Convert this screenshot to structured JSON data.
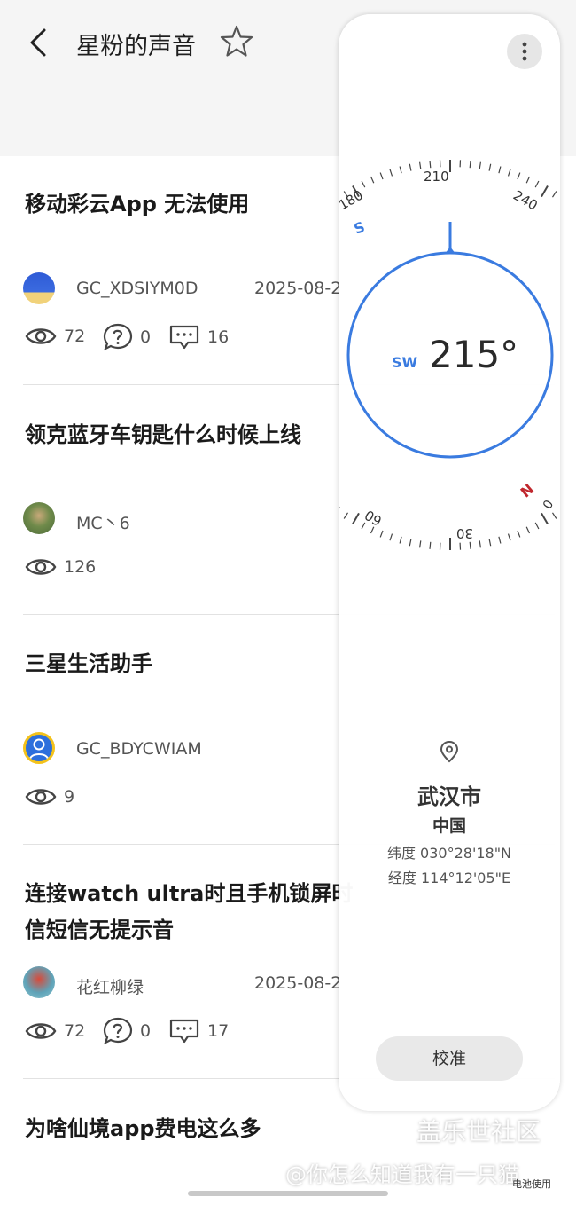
{
  "header": {
    "title": "星粉的声音"
  },
  "posts": [
    {
      "title": "移动彩云App 无法使用",
      "author": "GC_XDSIYM0D",
      "date": "2025-08-2",
      "views": "72",
      "questions": "0",
      "comments": "16"
    },
    {
      "title": "领克蓝牙车钥匙什么时候上线",
      "author": "MC丶6",
      "views": "126"
    },
    {
      "title": "三星生活助手",
      "author": "GC_BDYCWIAM",
      "views": "9"
    },
    {
      "title_line1": "连接watch ultra时且手机锁屏时",
      "title_line2": "信短信无提示音",
      "author": "花红柳绿",
      "date": "2025-08-2",
      "views": "72",
      "questions": "0",
      "comments": "17"
    },
    {
      "title": "为啥仙境app费电这么多"
    }
  ],
  "compass": {
    "heading": "215°",
    "direction": "SW",
    "dial_labels": [
      "180",
      "210",
      "240",
      "0",
      "30",
      "60"
    ],
    "cardinal_s": "S",
    "cardinal_n": "N",
    "city": "武汉市",
    "country": "中国",
    "latitude": "纬度 030°28'18\"N",
    "longitude": "经度 114°12'05\"E",
    "calibrate": "校准",
    "accent_color": "#3a7be0",
    "north_color": "#c0272d"
  },
  "watermark": {
    "site": "盖乐世社区",
    "user": "@你怎么知道我有一只猫"
  },
  "tip": "电池使用"
}
